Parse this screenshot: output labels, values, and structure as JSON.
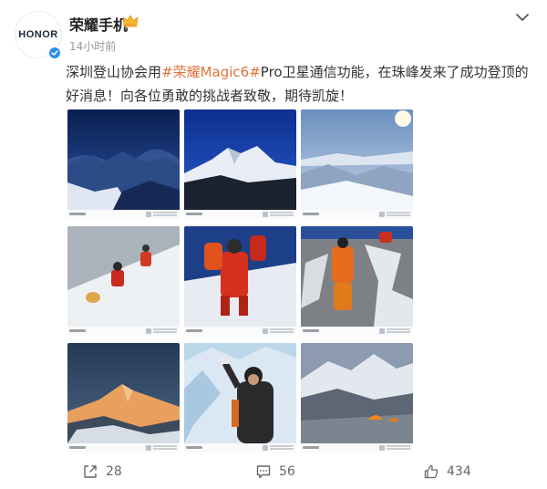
{
  "header": {
    "avatar_text": "HONOR",
    "username": "荣耀手机",
    "time": "14小时前"
  },
  "post": {
    "text_before": "深圳登山协会用",
    "topic": "#荣耀Magic6#",
    "text_after": "Pro卫星通信功能，在珠峰发来了成功登顶的好消息！向各位勇敢的挑战者致敬，期待凯旋！",
    "topic_color": "#e0713a"
  },
  "images": [
    {
      "subject": "clouds-above-peaks-night"
    },
    {
      "subject": "snow-peak-blue-sky"
    },
    {
      "subject": "high-altitude-sunrise-ridge"
    },
    {
      "subject": "climbers-on-snow-slope"
    },
    {
      "subject": "climbers-in-red-suits"
    },
    {
      "subject": "climber-on-rock-ladder"
    },
    {
      "subject": "everest-golden-summit"
    },
    {
      "subject": "climber-taking-selfie"
    },
    {
      "subject": "base-camp-tents"
    }
  ],
  "actions": {
    "repost_count": "28",
    "comment_count": "56",
    "like_count": "434"
  }
}
